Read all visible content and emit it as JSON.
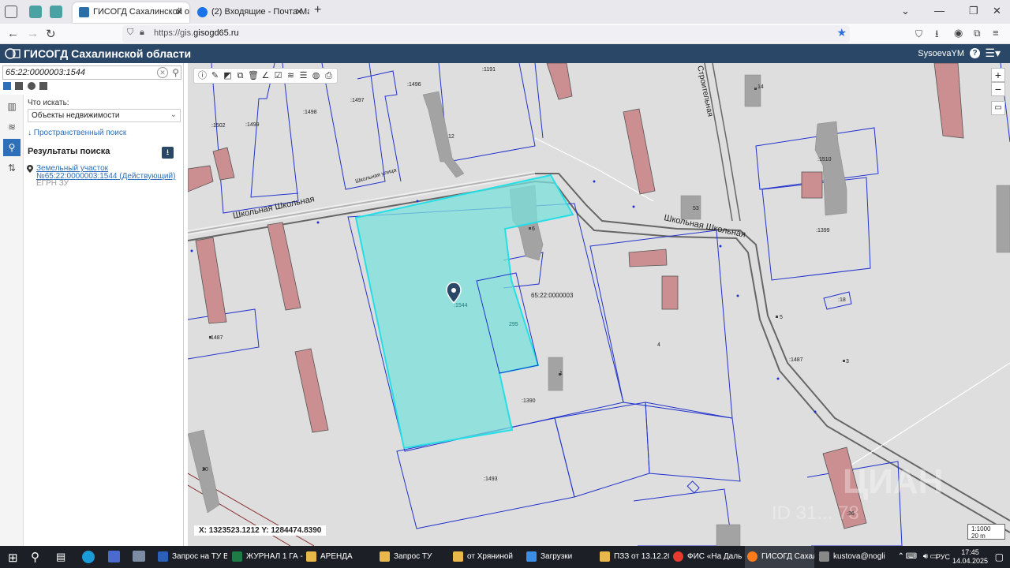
{
  "browser": {
    "tabs": [
      {
        "label": "ГИСОГД Сахалинской области",
        "active": true
      },
      {
        "label": "(2) Входящие - Почта Mail",
        "active": false
      }
    ],
    "url_prefix": "https://gis.",
    "url_domain": "gisogd65.ru"
  },
  "app": {
    "title": "ГИСОГД Сахалинской области",
    "user": "SysoevaYM",
    "help": "?",
    "menu_icon": "menu-icon"
  },
  "search": {
    "query": "65:22:0000003:1544",
    "what_label": "Что искать:",
    "what_value": "Объекты недвижимости",
    "spatial_link": "↓ Пространственный поиск",
    "results_title": "Результаты поиска",
    "result_link": "Земельный участок №65:22:0000003:1544 (Действующий)",
    "result_sub": "ЕГРН ЗУ"
  },
  "map": {
    "coords_label": "X: 1323523.1212   Y: 1284474.8390",
    "scale_ratio": "1:1000",
    "scale_bar": "20 m",
    "labels": {
      "street1": "Школьная Школьная",
      "street2": "Школьная Школьная",
      "street3": "Строительная",
      "street_small": "Школьная улица",
      "quarter": "65:22:0000003",
      "p1544": ":1544",
      "p295": "295",
      "p1390": ":1390",
      "p1493": ":1493",
      "p1399": ":1399",
      "p1487a": ":1487",
      "p1487b": ":1487",
      "p1496": ":1496",
      "p1497": ":1497",
      "p1498": ":1498",
      "p1499": ":1499",
      "p1502": ":1502",
      "p1191": ":1191",
      "p1510": ":1510",
      "p18": ":18",
      "h4": "4",
      "h5": "5",
      "h3": "3",
      "h6": "6",
      "h1": "1",
      "h20": "20",
      "h36": ":36",
      "h12": "12",
      "h53": "53",
      "h14": "14",
      "watermark": "ЦИАН",
      "watermark_id": "ID 31... 78"
    }
  },
  "taskbar": {
    "items": [
      {
        "label": "Запрос на ТУ В...",
        "color": "#2b5fb8"
      },
      {
        "label": "ЖУРНАЛ 1 ГА -...",
        "color": "#1e7b45"
      },
      {
        "label": "АРЕНДА",
        "color": "#e8b84a"
      },
      {
        "label": "Запрос ТУ",
        "color": "#e8b84a"
      },
      {
        "label": "от Хряниной",
        "color": "#e8b84a"
      },
      {
        "label": "Загрузки",
        "color": "#3a8ee6"
      },
      {
        "label": "ПЗЗ от 13.12.20...",
        "color": "#e8b84a"
      },
      {
        "label": "ФИС «На Даль...",
        "color": "#e63b2e"
      },
      {
        "label": "ГИСОГД Сахал...",
        "color": "#ff7b1a"
      },
      {
        "label": "kustova@nogli...",
        "color": "#888888"
      }
    ],
    "lang": "РУС",
    "time": "17:45",
    "date": "14.04.2025"
  }
}
